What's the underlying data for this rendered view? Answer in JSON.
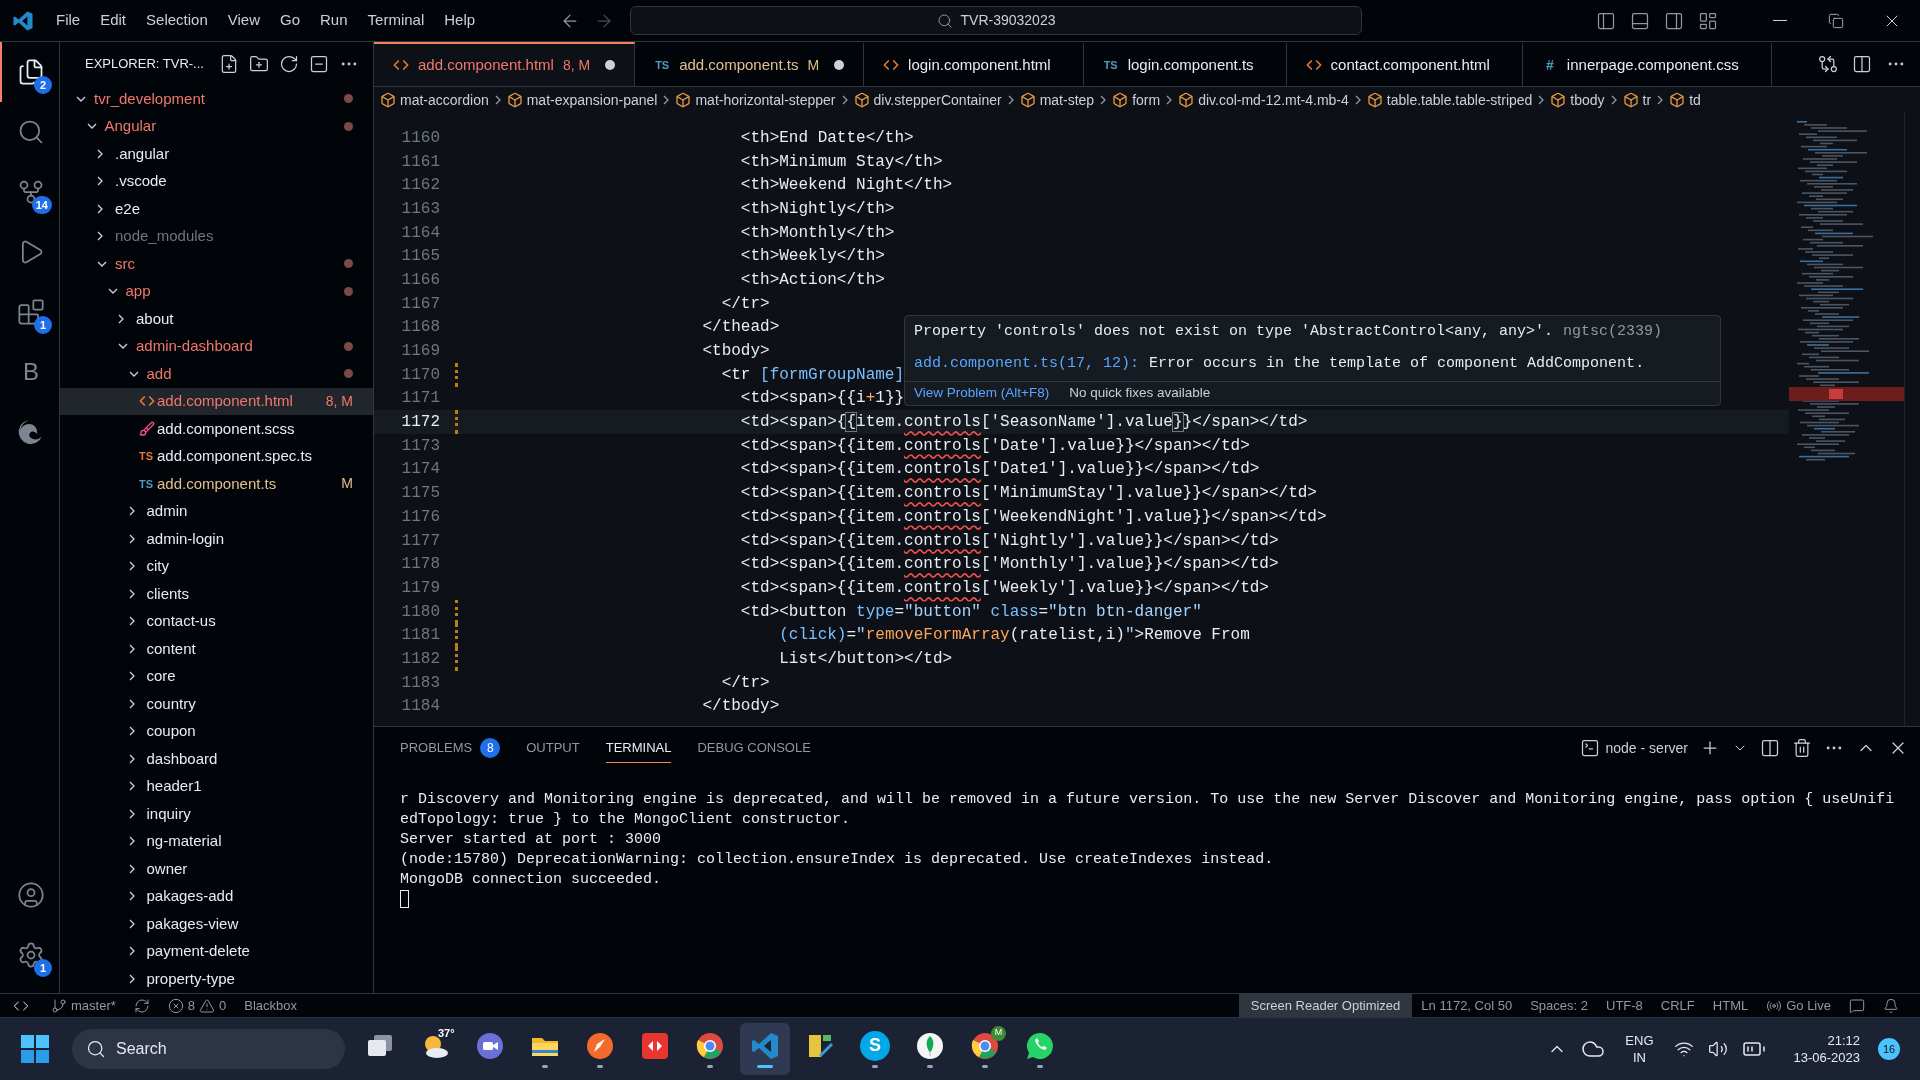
{
  "title_bar": {
    "menu": [
      "File",
      "Edit",
      "Selection",
      "View",
      "Go",
      "Run",
      "Terminal",
      "Help"
    ],
    "command_center": "TVR-39032023"
  },
  "activity_bar": {
    "top": [
      {
        "kind": "explorer",
        "badge": "2",
        "selected": true
      },
      {
        "kind": "search",
        "selected": false
      },
      {
        "kind": "scm",
        "badge": "14",
        "selected": false
      },
      {
        "kind": "run",
        "selected": false
      },
      {
        "kind": "extensions",
        "badge": "1",
        "selected": false
      },
      {
        "kind": "letter",
        "text": "B",
        "selected": false
      },
      {
        "kind": "edge",
        "selected": false
      }
    ],
    "bottom": [
      {
        "kind": "accounts",
        "selected": false
      },
      {
        "kind": "settings",
        "badge": "1",
        "selected": false
      }
    ]
  },
  "explorer": {
    "title": "EXPLORER: TVR-...",
    "tree": [
      {
        "name": "tvr_development",
        "kind": "folder",
        "expanded": true,
        "color": "#f0786a",
        "dot": true,
        "selected": false,
        "children": [
          {
            "name": "Angular",
            "kind": "folder",
            "expanded": true,
            "color": "#f0786a",
            "dot": true,
            "selected": false,
            "children": [
              {
                "name": ".angular",
                "kind": "folder",
                "expanded": false,
                "color": "#e6edf3",
                "dot": false,
                "selected": false
              },
              {
                "name": ".vscode",
                "kind": "folder",
                "expanded": false,
                "color": "#e6edf3",
                "dot": false,
                "selected": false
              },
              {
                "name": "e2e",
                "kind": "folder",
                "expanded": false,
                "color": "#e6edf3",
                "dot": false,
                "selected": false
              },
              {
                "name": "node_modules",
                "kind": "folder",
                "expanded": false,
                "color": "#6e7681",
                "dot": false,
                "selected": false
              },
              {
                "name": "src",
                "kind": "folder",
                "expanded": true,
                "color": "#f0786a",
                "dot": true,
                "selected": false,
                "children": [
                  {
                    "name": "app",
                    "kind": "folder",
                    "expanded": true,
                    "color": "#f0786a",
                    "dot": true,
                    "selected": false,
                    "children": [
                      {
                        "name": "about",
                        "kind": "folder",
                        "expanded": false,
                        "color": "#e6edf3",
                        "dot": false,
                        "selected": false
                      },
                      {
                        "name": "admin-dashboard",
                        "kind": "folder",
                        "expanded": true,
                        "color": "#f0786a",
                        "dot": true,
                        "selected": false,
                        "children": [
                          {
                            "name": "add",
                            "kind": "folder",
                            "expanded": true,
                            "color": "#f0786a",
                            "dot": true,
                            "selected": false,
                            "children": [
                              {
                                "name": "add.component.html",
                                "kind": "html",
                                "color": "#f0786a",
                                "badge": "8, M",
                                "dot": false,
                                "selected": true
                              },
                              {
                                "name": "add.component.scss",
                                "kind": "scss",
                                "color": "#e6edf3",
                                "dot": false,
                                "selected": false
                              },
                              {
                                "name": "add.component.spec.ts",
                                "kind": "spec",
                                "icon_label": "TS",
                                "color": "#e6edf3",
                                "dot": false,
                                "selected": false
                              },
                              {
                                "name": "add.component.ts",
                                "kind": "ts",
                                "icon_label": "TS",
                                "color": "#e2c08d",
                                "badge": "M",
                                "dot": false,
                                "selected": false
                              }
                            ]
                          },
                          {
                            "name": "admin",
                            "kind": "folder",
                            "expanded": false,
                            "color": "#e6edf3",
                            "dot": false,
                            "selected": false
                          },
                          {
                            "name": "admin-login",
                            "kind": "folder",
                            "expanded": false,
                            "color": "#e6edf3",
                            "dot": false,
                            "selected": false
                          },
                          {
                            "name": "city",
                            "kind": "folder",
                            "expanded": false,
                            "color": "#e6edf3",
                            "dot": false,
                            "selected": false
                          },
                          {
                            "name": "clients",
                            "kind": "folder",
                            "expanded": false,
                            "color": "#e6edf3",
                            "dot": false,
                            "selected": false
                          },
                          {
                            "name": "contact-us",
                            "kind": "folder",
                            "expanded": false,
                            "color": "#e6edf3",
                            "dot": false,
                            "selected": false
                          },
                          {
                            "name": "content",
                            "kind": "folder",
                            "expanded": false,
                            "color": "#e6edf3",
                            "dot": false,
                            "selected": false
                          },
                          {
                            "name": "core",
                            "kind": "folder",
                            "expanded": false,
                            "color": "#e6edf3",
                            "dot": false,
                            "selected": false
                          },
                          {
                            "name": "country",
                            "kind": "folder",
                            "expanded": false,
                            "color": "#e6edf3",
                            "dot": false,
                            "selected": false
                          },
                          {
                            "name": "coupon",
                            "kind": "folder",
                            "expanded": false,
                            "color": "#e6edf3",
                            "dot": false,
                            "selected": false
                          },
                          {
                            "name": "dashboard",
                            "kind": "folder",
                            "expanded": false,
                            "color": "#e6edf3",
                            "dot": false,
                            "selected": false
                          },
                          {
                            "name": "header1",
                            "kind": "folder",
                            "expanded": false,
                            "color": "#e6edf3",
                            "dot": false,
                            "selected": false
                          },
                          {
                            "name": "inquiry",
                            "kind": "folder",
                            "expanded": false,
                            "color": "#e6edf3",
                            "dot": false,
                            "selected": false
                          },
                          {
                            "name": "ng-material",
                            "kind": "folder",
                            "expanded": false,
                            "color": "#e6edf3",
                            "dot": false,
                            "selected": false
                          },
                          {
                            "name": "owner",
                            "kind": "folder",
                            "expanded": false,
                            "color": "#e6edf3",
                            "dot": false,
                            "selected": false
                          },
                          {
                            "name": "pakages-add",
                            "kind": "folder",
                            "expanded": false,
                            "color": "#e6edf3",
                            "dot": false,
                            "selected": false
                          },
                          {
                            "name": "pakages-view",
                            "kind": "folder",
                            "expanded": false,
                            "color": "#e6edf3",
                            "dot": false,
                            "selected": false
                          },
                          {
                            "name": "payment-delete",
                            "kind": "folder",
                            "expanded": false,
                            "color": "#e6edf3",
                            "dot": false,
                            "selected": false
                          },
                          {
                            "name": "property-type",
                            "kind": "folder",
                            "expanded": false,
                            "color": "#e6edf3",
                            "dot": false,
                            "selected": false
                          }
                        ]
                      }
                    ]
                  }
                ]
              }
            ]
          }
        ]
      }
    ]
  },
  "tabs": [
    {
      "label": "add.component.html",
      "kind": "html",
      "badge": "8, M",
      "color": "#f0786a",
      "dirty": true,
      "selected": true
    },
    {
      "label": "add.component.ts",
      "kind": "ts",
      "icon_label": "TS",
      "badge": "M",
      "color": "#e2c08d",
      "dirty": true,
      "selected": false
    },
    {
      "label": "login.component.html",
      "kind": "html",
      "color": "#e6edf3",
      "dirty": false,
      "selected": false
    },
    {
      "label": "login.component.ts",
      "kind": "ts",
      "icon_label": "TS",
      "color": "#e6edf3",
      "dirty": false,
      "selected": false
    },
    {
      "label": "contact.component.html",
      "kind": "html",
      "color": "#e6edf3",
      "dirty": false,
      "selected": false
    },
    {
      "label": "innerpage.component.css",
      "kind": "css",
      "icon_label": "#",
      "color": "#e6edf3",
      "dirty": false,
      "selected": false
    }
  ],
  "breadcrumbs": [
    "mat-accordion",
    "mat-expansion-panel",
    "mat-horizontal-stepper",
    "div.stepperContainer",
    "mat-step",
    "form",
    "div.col-md-12.mt-4.mb-4",
    "table.table.table-striped",
    "tbody",
    "tr",
    "td"
  ],
  "code": [
    {
      "number": "1160",
      "modified": false,
      "current": false,
      "tokens": [
        {
          "t": "                            <th>End Datte</th>",
          "kind": "plain"
        }
      ]
    },
    {
      "number": "1161",
      "modified": false,
      "current": false,
      "tokens": [
        {
          "t": "                            <th>Minimum Stay</th>",
          "kind": "plain"
        }
      ]
    },
    {
      "number": "1162",
      "modified": false,
      "current": false,
      "tokens": [
        {
          "t": "                            <th>Weekend Night</th>",
          "kind": "plain"
        }
      ]
    },
    {
      "number": "1163",
      "modified": false,
      "current": false,
      "tokens": [
        {
          "t": "                            <th>Nightly</th>",
          "kind": "plain"
        }
      ]
    },
    {
      "number": "1164",
      "modified": false,
      "current": false,
      "tokens": [
        {
          "t": "                            <th>Monthly</th>",
          "kind": "plain"
        }
      ]
    },
    {
      "number": "1165",
      "modified": false,
      "current": false,
      "tokens": [
        {
          "t": "                            <th>Weekly</th>",
          "kind": "plain"
        }
      ]
    },
    {
      "number": "1166",
      "modified": false,
      "current": false,
      "tokens": [
        {
          "t": "                            <th>Action</th>",
          "kind": "plain"
        }
      ]
    },
    {
      "number": "1167",
      "modified": false,
      "current": false,
      "tokens": [
        {
          "t": "                          </tr>",
          "kind": "plain"
        }
      ]
    },
    {
      "number": "1168",
      "modified": false,
      "current": false,
      "tokens": [
        {
          "t": "                        </thead>",
          "kind": "plain"
        }
      ]
    },
    {
      "number": "1169",
      "modified": false,
      "current": false,
      "tokens": [
        {
          "t": "                        <tbody>",
          "kind": "plain"
        }
      ]
    },
    {
      "number": "1170",
      "modified": true,
      "current": false,
      "tokens": [
        {
          "t": "                          <tr ",
          "kind": "plain"
        },
        {
          "t": "[formGroupName]",
          "kind": "attr"
        }
      ]
    },
    {
      "number": "1171",
      "modified": false,
      "current": false,
      "tokens": [
        {
          "t": "                            <td><span>{{i",
          "kind": "plain"
        },
        {
          "t": "+",
          "kind": "func"
        },
        {
          "t": "1}}",
          "kind": "plain"
        }
      ]
    },
    {
      "number": "1172",
      "modified": true,
      "current": true,
      "tokens": [
        {
          "t": "                            <td><span>{",
          "kind": "plain"
        },
        {
          "t": "{",
          "kind": "match"
        },
        {
          "t": "item.",
          "kind": "plain"
        },
        {
          "t": "controls",
          "kind": "error"
        },
        {
          "t": "['SeasonName'].value",
          "kind": "plain"
        },
        {
          "t": "}",
          "kind": "match"
        },
        {
          "t": "}</span></td>",
          "kind": "plain"
        }
      ]
    },
    {
      "number": "1173",
      "modified": false,
      "current": false,
      "tokens": [
        {
          "t": "                            <td><span>{{item.",
          "kind": "plain"
        },
        {
          "t": "controls",
          "kind": "error"
        },
        {
          "t": "['Date'].value}}</span></td>",
          "kind": "plain"
        }
      ]
    },
    {
      "number": "1174",
      "modified": false,
      "current": false,
      "tokens": [
        {
          "t": "                            <td><span>{{item.",
          "kind": "plain"
        },
        {
          "t": "controls",
          "kind": "error"
        },
        {
          "t": "['Date1'].value}}</span></td>",
          "kind": "plain"
        }
      ]
    },
    {
      "number": "1175",
      "modified": false,
      "current": false,
      "tokens": [
        {
          "t": "                            <td><span>{{item.",
          "kind": "plain"
        },
        {
          "t": "controls",
          "kind": "error"
        },
        {
          "t": "['MinimumStay'].value}}</span></td>",
          "kind": "plain"
        }
      ]
    },
    {
      "number": "1176",
      "modified": false,
      "current": false,
      "tokens": [
        {
          "t": "                            <td><span>{{item.",
          "kind": "plain"
        },
        {
          "t": "controls",
          "kind": "error"
        },
        {
          "t": "['WeekendNight'].value}}</span></td>",
          "kind": "plain"
        }
      ]
    },
    {
      "number": "1177",
      "modified": false,
      "current": false,
      "tokens": [
        {
          "t": "                            <td><span>{{item.",
          "kind": "plain"
        },
        {
          "t": "controls",
          "kind": "error"
        },
        {
          "t": "['Nightly'].value}}</span></td>",
          "kind": "plain"
        }
      ]
    },
    {
      "number": "1178",
      "modified": false,
      "current": false,
      "tokens": [
        {
          "t": "                            <td><span>{{item.",
          "kind": "plain"
        },
        {
          "t": "controls",
          "kind": "error"
        },
        {
          "t": "['Monthly'].value}}</span></td>",
          "kind": "plain"
        }
      ]
    },
    {
      "number": "1179",
      "modified": false,
      "current": false,
      "tokens": [
        {
          "t": "                            <td><span>{{item.",
          "kind": "plain"
        },
        {
          "t": "controls",
          "kind": "error"
        },
        {
          "t": "['Weekly'].value}}</span></td>",
          "kind": "plain"
        }
      ]
    },
    {
      "number": "1180",
      "modified": true,
      "current": false,
      "tokens": [
        {
          "t": "                            <td><button ",
          "kind": "plain"
        },
        {
          "t": "type",
          "kind": "attr"
        },
        {
          "t": "=",
          "kind": "plain"
        },
        {
          "t": "\"button\"",
          "kind": "string"
        },
        {
          "t": " class",
          "kind": "attr"
        },
        {
          "t": "=",
          "kind": "plain"
        },
        {
          "t": "\"btn btn-danger\"",
          "kind": "string"
        }
      ]
    },
    {
      "number": "1181",
      "modified": true,
      "current": false,
      "tokens": [
        {
          "t": "                                (click)",
          "kind": "attr"
        },
        {
          "t": "=",
          "kind": "plain"
        },
        {
          "t": "\"",
          "kind": "string"
        },
        {
          "t": "removeFormArray",
          "kind": "func"
        },
        {
          "t": "(ratelist,i)",
          "kind": "plain"
        },
        {
          "t": "\"",
          "kind": "string"
        },
        {
          "t": ">Remove From",
          "kind": "plain"
        }
      ]
    },
    {
      "number": "1182",
      "modified": true,
      "current": false,
      "tokens": [
        {
          "t": "                                List</button></td>",
          "kind": "plain"
        }
      ]
    },
    {
      "number": "1183",
      "modified": false,
      "current": false,
      "tokens": [
        {
          "t": "                          </tr>",
          "kind": "plain"
        }
      ]
    },
    {
      "number": "1184",
      "modified": false,
      "current": false,
      "tokens": [
        {
          "t": "                        </tbody>",
          "kind": "plain"
        }
      ]
    }
  ],
  "hover": {
    "message": "Property 'controls' does not exist on type 'AbstractControl<any, any>'.",
    "code": "ngtsc(2339)",
    "source_link": "add.component.ts(17, 12):",
    "source_text": "Error occurs in the template of component AddComponent.",
    "action": "View Problem (Alt+F8)",
    "note": "No quick fixes available"
  },
  "panel": {
    "tabs": [
      {
        "label": "PROBLEMS",
        "badge": "8",
        "selected": false
      },
      {
        "label": "OUTPUT",
        "selected": false
      },
      {
        "label": "TERMINAL",
        "selected": true
      },
      {
        "label": "DEBUG CONSOLE",
        "selected": false
      }
    ],
    "terminal_name": "node - server",
    "lines": [
      "r Discovery and Monitoring engine is deprecated, and will be removed in a future version. To use the new Server Discover and Monitoring engine, pass option { useUnifi",
      "edTopology: true } to the MongoClient constructor.",
      "Server started at port : 3000",
      "(node:15780) DeprecationWarning: collection.ensureIndex is deprecated. Use createIndexes instead.",
      "MongoDB connection succeeded."
    ]
  },
  "status_bar": {
    "left": [
      {
        "kind": "remote"
      },
      {
        "kind": "branch",
        "text": "master*"
      },
      {
        "kind": "sync"
      },
      {
        "kind": "problems",
        "errors": "8",
        "warnings": "0"
      },
      {
        "kind": "plain",
        "text": "Blackbox"
      }
    ],
    "right": [
      {
        "kind": "highlight",
        "text": "Screen Reader Optimized"
      },
      {
        "kind": "plain",
        "text": "Ln 1172, Col 50"
      },
      {
        "kind": "plain",
        "text": "Spaces: 2"
      },
      {
        "kind": "plain",
        "text": "UTF-8"
      },
      {
        "kind": "plain",
        "text": "CRLF"
      },
      {
        "kind": "plain",
        "text": "HTML"
      },
      {
        "kind": "golive",
        "text": "Go Live"
      },
      {
        "kind": "feedback"
      },
      {
        "kind": "bell"
      }
    ]
  },
  "taskbar": {
    "search": "Search",
    "apps": [
      {
        "kind": "taskview",
        "running": false,
        "active": false
      },
      {
        "kind": "weather",
        "text": "37°",
        "running": false,
        "active": false
      },
      {
        "kind": "meet",
        "running": false,
        "active": false
      },
      {
        "kind": "files",
        "running": true,
        "active": false
      },
      {
        "kind": "pen",
        "running": true,
        "active": false
      },
      {
        "kind": "arrows",
        "running": false,
        "active": false
      },
      {
        "kind": "chrome",
        "running": true,
        "active": false
      },
      {
        "kind": "vscode",
        "running": true,
        "active": true
      },
      {
        "kind": "tool",
        "running": false,
        "active": false
      },
      {
        "kind": "skype",
        "glyph": "S",
        "running": true,
        "active": false
      },
      {
        "kind": "mongo",
        "running": true,
        "active": false
      },
      {
        "kind": "chrome",
        "badge": "M",
        "running": true,
        "active": false
      },
      {
        "kind": "whatsapp",
        "running": true,
        "active": false
      }
    ],
    "language": "ENG",
    "region": "IN",
    "time": "21:12",
    "date": "13-06-2023",
    "notifications": "16"
  }
}
